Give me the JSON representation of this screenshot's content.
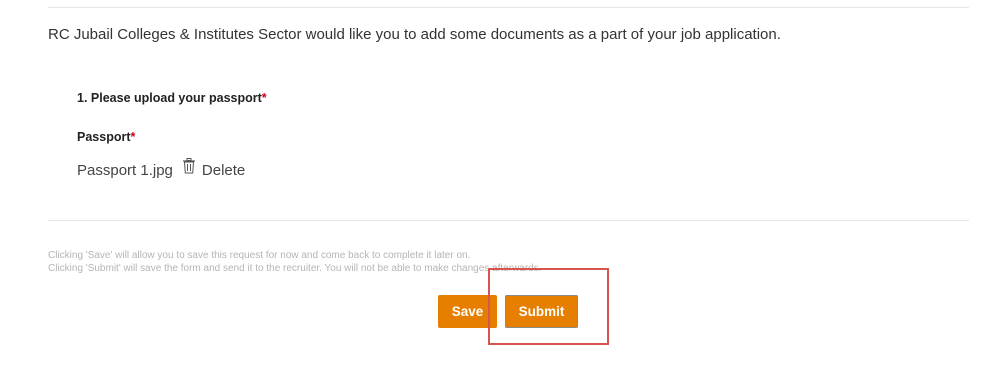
{
  "intro_text": "RC Jubail Colleges & Institutes Sector would like you to add some documents as a part of your job application.",
  "question": {
    "label": "1. Please upload your passport",
    "required_mark": "*"
  },
  "field": {
    "label": "Passport",
    "required_mark": "*",
    "file_name": "Passport 1.jpg",
    "delete_label": "Delete",
    "delete_icon": "trash-icon"
  },
  "help": {
    "save_note": "Clicking 'Save' will allow you to save this request for now and come back to complete it later on.",
    "submit_note": "Clicking 'Submit' will save the form and send it to the recruiter. You will not be able to make changes afterwards."
  },
  "actions": {
    "save_label": "Save",
    "submit_label": "Submit"
  },
  "colors": {
    "button_bg": "#e67e00",
    "required": "#d0021b",
    "highlight": "#d9534f"
  }
}
